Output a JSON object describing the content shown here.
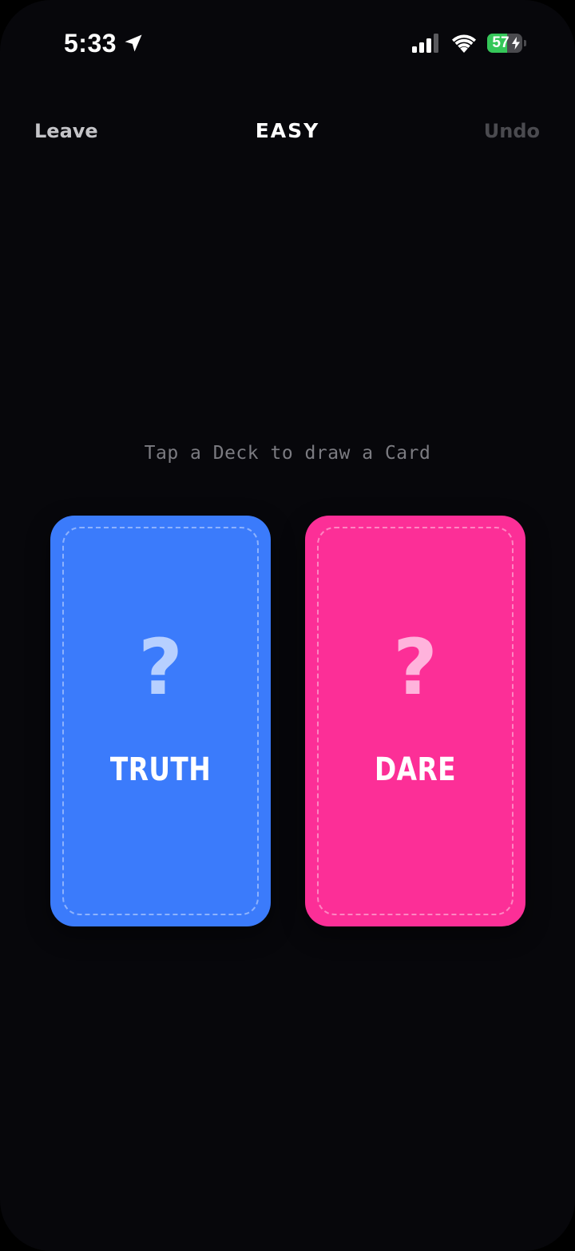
{
  "status_bar": {
    "time": "5:33",
    "battery_level": "57",
    "battery_fraction": 0.57,
    "icons": [
      "location-arrow-icon",
      "cellular-signal-icon",
      "wifi-icon",
      "battery-charging-icon"
    ]
  },
  "nav": {
    "leave_label": "Leave",
    "title": "EASY",
    "undo_label": "Undo"
  },
  "hint": "Tap a Deck to draw a Card",
  "decks": {
    "truth": {
      "symbol": "?",
      "label": "TRUTH",
      "color": "#3b7bfb",
      "symbol_color": "#b7d0ff"
    },
    "dare": {
      "symbol": "?",
      "label": "DARE",
      "color": "#fc2f97",
      "symbol_color": "#ffb3dc"
    }
  }
}
